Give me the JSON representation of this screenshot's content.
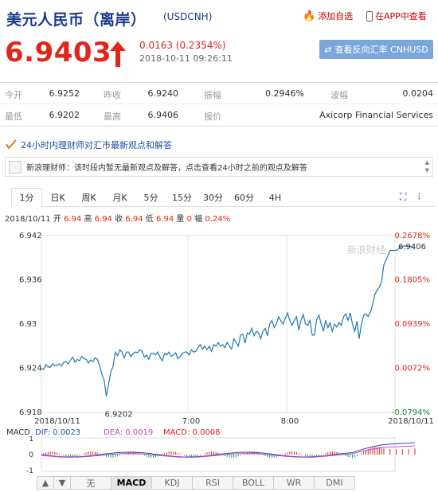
{
  "header": {
    "title": "美元人民币（离岸）",
    "code": "(USDCNH)",
    "add_favorite": "添加自选",
    "app_view": "在APP中查看",
    "price": "6.9403",
    "change": "0.0163 (0.2354%)",
    "datetime": "2018-10-11 09:26:11",
    "reverse_button": "查看反向汇率 CNHUSD"
  },
  "stats": {
    "row1": [
      {
        "label": "今开",
        "value": "6.9252"
      },
      {
        "label": "昨收",
        "value": "6.9240"
      },
      {
        "label": "振幅",
        "value": "0.2946%"
      },
      {
        "label": "波幅",
        "value": "0.0204"
      }
    ],
    "row2": [
      {
        "label": "最低",
        "value": "6.9202"
      },
      {
        "label": "最高",
        "value": "6.9406"
      },
      {
        "label": "报价",
        "value": "Axicorp Financial Services"
      }
    ]
  },
  "viewpoint": {
    "link": "24小时内理财师对汇市最新观点和解答",
    "message": "新浪理财师：该时段内暂无最新观点及解答，点击查看24小时之前的观点及解答"
  },
  "tabs": [
    "1分",
    "日K",
    "周K",
    "月K",
    "5分",
    "15分",
    "30分",
    "60分",
    "4H"
  ],
  "info": {
    "date": "2018/10/11",
    "open_label": "开",
    "open": "6.94",
    "high_label": "高",
    "high": "6.94",
    "close_label": "收",
    "close": "6.94",
    "low_label": "低",
    "low": "6.94",
    "vol_label": "量",
    "vol": "0",
    "amp_label": "幅",
    "amp": "0.24%"
  },
  "chart_data": {
    "type": "line",
    "y_ticks": [
      "6.942",
      "6.936",
      "6.93",
      "6.924",
      "6.918"
    ],
    "y_pct_ticks": [
      "0.2678%",
      "0.1805%",
      "0.0939%",
      "0.0072%",
      "-0.0794%"
    ],
    "x_ticks": [
      "2018/10/11",
      "7:00",
      "8:00",
      "2018/10/11"
    ],
    "ylim": [
      6.918,
      6.942
    ],
    "watermark": "新浪财经",
    "high_label": "6.9406",
    "low_label": "6.9202",
    "points": [
      6.924,
      6.9238,
      6.9245,
      6.9242,
      6.9241,
      6.9246,
      6.9243,
      6.9244,
      6.9246,
      6.9243,
      6.9248,
      6.9249,
      6.9246,
      6.9251,
      6.9255,
      6.9248,
      6.9252,
      6.925,
      6.9256,
      6.9253,
      6.9252,
      6.9247,
      6.9251,
      6.9249,
      6.9254,
      6.9252,
      6.9244,
      6.9232,
      6.9224,
      6.9202,
      6.9218,
      6.9235,
      6.9242,
      6.9262,
      6.9257,
      6.9265,
      6.9262,
      6.9254,
      6.9262,
      6.9262,
      6.9256,
      6.926,
      6.9262,
      6.9261,
      6.9265,
      6.9263,
      6.9255,
      6.9258,
      6.9252,
      6.926,
      6.926,
      6.9258,
      6.9262,
      6.9255,
      6.925,
      6.926,
      6.9258,
      6.9262,
      6.9256,
      6.9258,
      6.9261,
      6.9253,
      6.9256,
      6.926,
      6.9262,
      6.9262,
      6.9258,
      6.9265,
      6.9262,
      6.9263,
      6.9268,
      6.9272,
      6.9266,
      6.927,
      6.9265,
      6.927,
      6.9263,
      6.9272,
      6.927,
      6.9275,
      6.927,
      6.9272,
      6.9268,
      6.9275,
      6.927,
      6.9266,
      6.928,
      6.9275,
      6.927,
      6.9285,
      6.9286,
      6.9274,
      6.9288,
      6.9286,
      6.9294,
      6.9284,
      6.929,
      6.9288,
      6.928,
      6.929,
      6.9294,
      6.9284,
      6.93,
      6.9305,
      6.9295,
      6.93,
      6.931,
      6.9304,
      6.93,
      6.9308,
      6.9315,
      6.9305,
      6.9298,
      6.9305,
      6.931,
      6.9292,
      6.9305,
      6.9313,
      6.93,
      6.9298,
      6.9305,
      6.9285,
      6.9285,
      6.9306,
      6.9312,
      6.93,
      6.929,
      6.9305,
      6.9295,
      6.9302,
      6.929,
      6.93,
      6.9296,
      6.9302,
      6.9298,
      6.931,
      6.9314,
      6.9305,
      6.9315,
      6.93,
      6.929,
      6.9304,
      6.928,
      6.93,
      6.9312,
      6.9314,
      6.931,
      6.9316,
      6.9326,
      6.934,
      6.9346,
      6.935,
      6.9357,
      6.938,
      6.94,
      6.94,
      6.9406,
      6.9406,
      6.9403
    ]
  },
  "macd": {
    "label": "MACD",
    "dif": "DIF: 0.0023",
    "dea": "DEA: 0.0019",
    "macd": "MACD: 0.0008",
    "y_ticks": [
      "1",
      "0",
      "-1"
    ]
  },
  "bottom_tabs": [
    "无",
    "MACD",
    "KDJ",
    "RSI",
    "BOLL",
    "WR",
    "DMI"
  ],
  "colors": {
    "accent": "#1a3a8c",
    "up": "#e0261b",
    "line": "#1f77b4",
    "dif": "#1f4fbf",
    "dea": "#cc44cc"
  }
}
